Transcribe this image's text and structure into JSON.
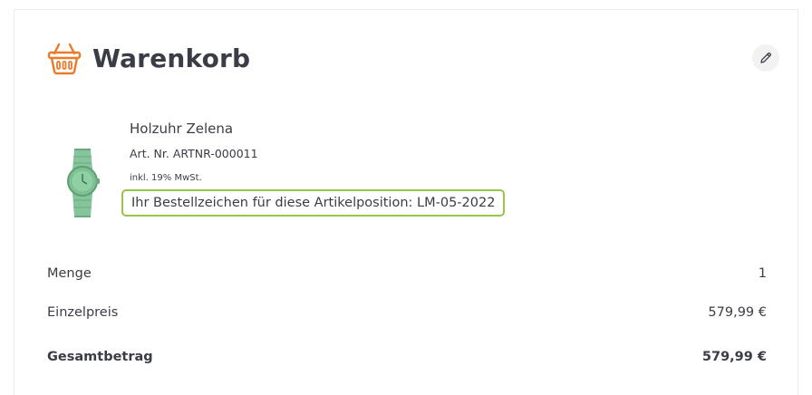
{
  "header": {
    "title": "Warenkorb",
    "icon": "basket-icon",
    "edit_icon": "pencil-icon"
  },
  "item": {
    "name": "Holzuhr Zelena",
    "article_number": "Art. Nr. ARTNR-000011",
    "tax_note": "inkl. 19% MwSt.",
    "order_reference": "Ihr Bestellzeichen für diese Artikelposition: LM-05-2022"
  },
  "summary": {
    "quantity_label": "Menge",
    "quantity_value": "1",
    "unit_price_label": "Einzelpreis",
    "unit_price_value": "579,99 €",
    "total_label": "Gesamtbetrag",
    "total_value": "579,99 €"
  },
  "colors": {
    "accent_orange": "#ec7a2c",
    "highlight_green": "#97c54a",
    "text": "#3a3d45",
    "watch_green": "#7fbf94"
  }
}
